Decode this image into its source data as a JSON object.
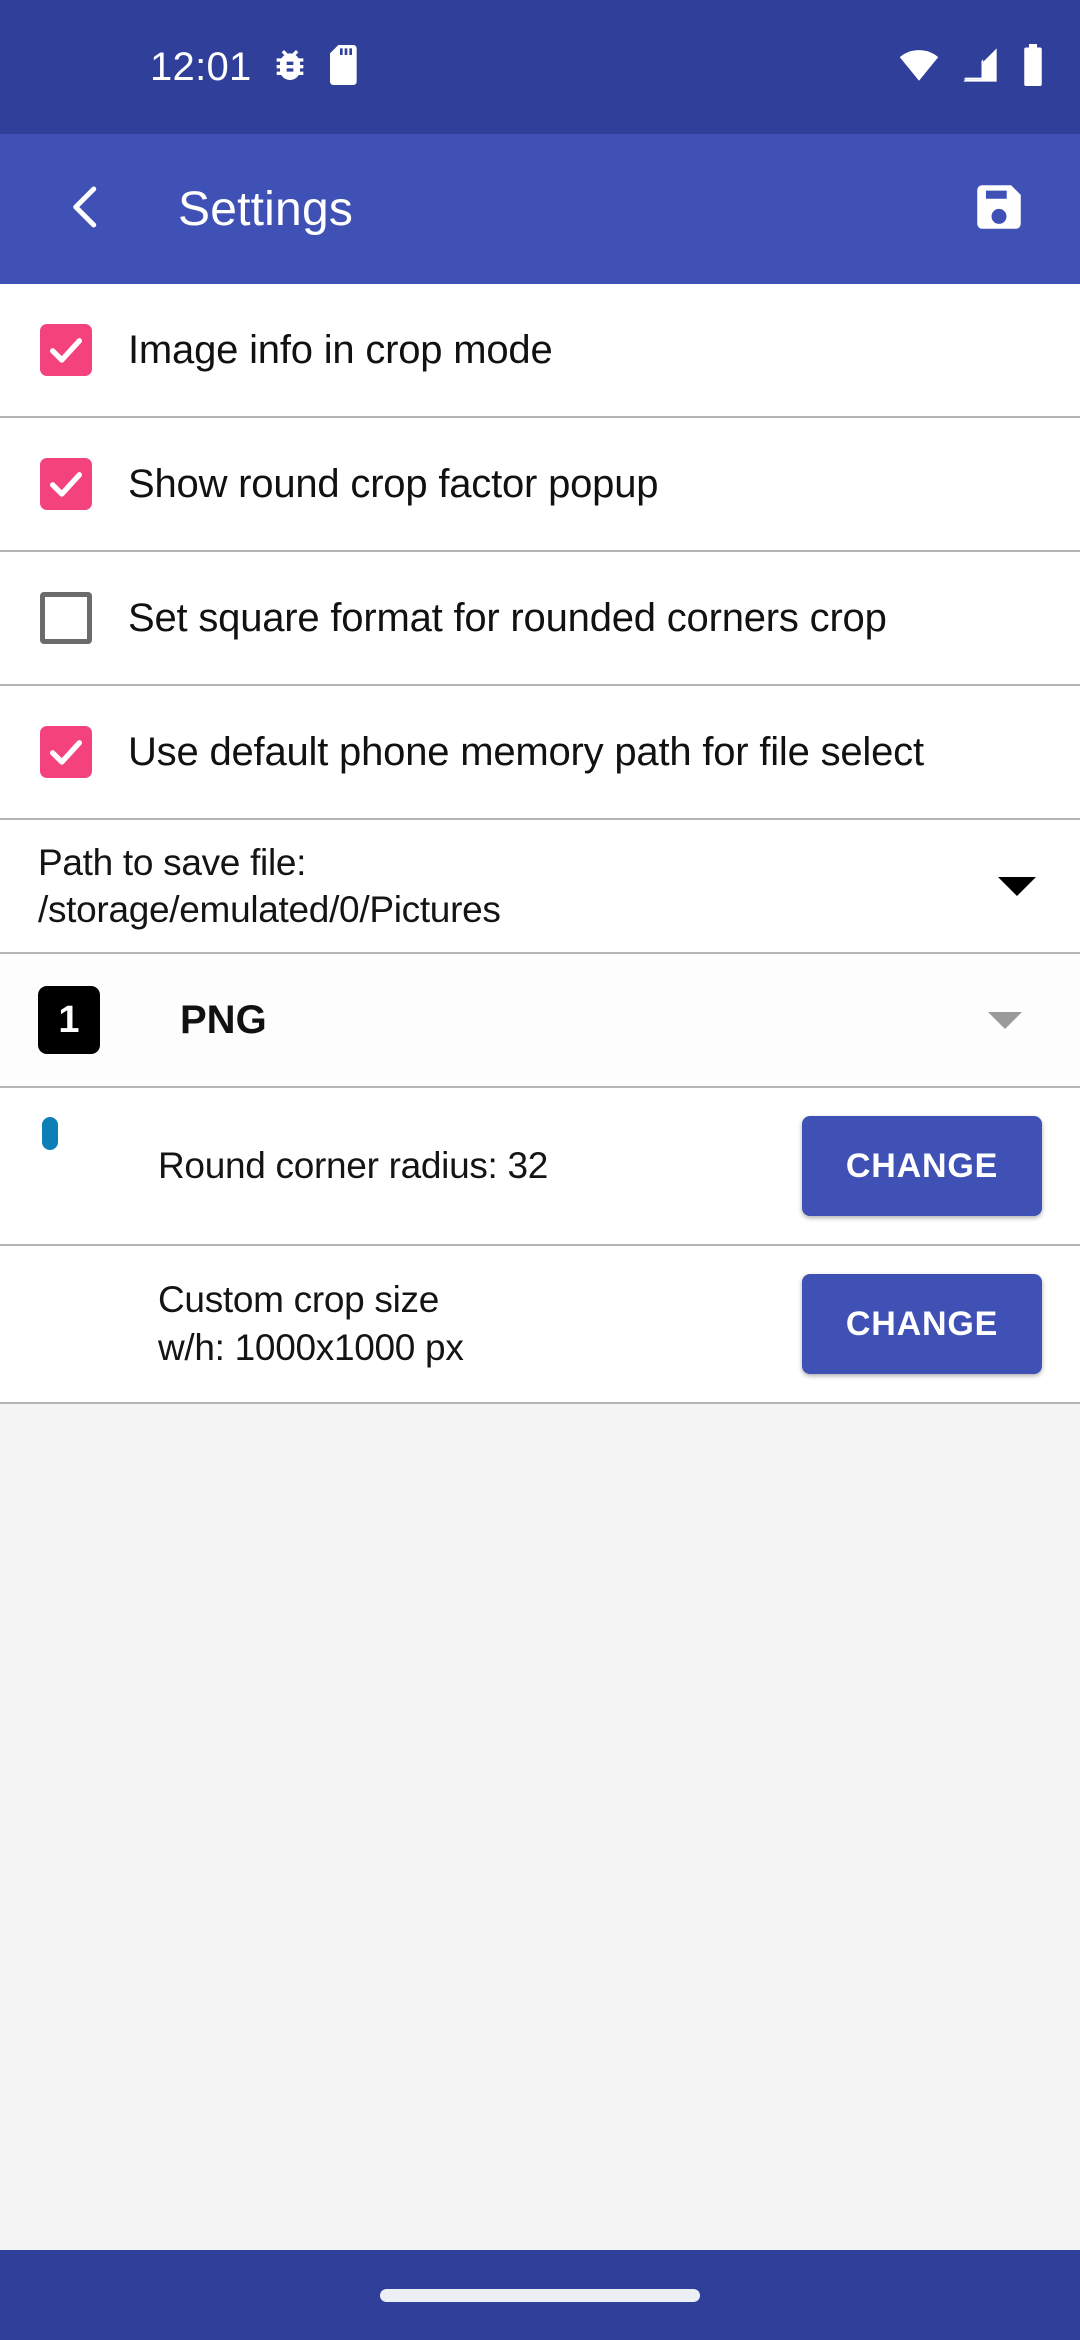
{
  "statusbar": {
    "time": "12:01",
    "icons": [
      "bug-icon",
      "sd-card-icon",
      "wifi-icon",
      "cellular-signal-icon",
      "battery-icon"
    ]
  },
  "appbar": {
    "back_icon": "back-chevron-icon",
    "title": "Settings",
    "save_icon": "save-floppy-icon",
    "background": "#3f51b5"
  },
  "settings": {
    "checkboxes": [
      {
        "label": "Image info in crop mode",
        "checked": true
      },
      {
        "label": "Show round crop factor popup",
        "checked": true
      },
      {
        "label": "Set square format for rounded corners crop",
        "checked": false
      },
      {
        "label": "Use default phone memory path for file select",
        "checked": true
      }
    ],
    "path_row": {
      "label": "Path to save file:",
      "value": "/storage/emulated/0/Pictures",
      "dropdown_icon": "chevron-down-icon"
    },
    "format_row": {
      "badge": "1",
      "value": "PNG",
      "dropdown_icon": "chevron-down-icon"
    },
    "action_rows": [
      {
        "icon": "rounded-rect-icon",
        "line1": "Round corner radius: 32",
        "line2": "",
        "button": "CHANGE"
      },
      {
        "icon": "diagonal-stripes-icon",
        "line1": "Custom crop size",
        "line2": "w/h: 1000x1000 px",
        "button": "CHANGE"
      }
    ]
  },
  "colors": {
    "status_bar": "#2f3f9a",
    "app_bar": "#3f51b5",
    "checkbox_on": "#f4427d",
    "accent_icon": "#0d7fb7",
    "button": "#3f51b5",
    "page_bg": "#f4f4f4"
  },
  "navbar": {
    "handle": "gesture-nav-pill"
  }
}
